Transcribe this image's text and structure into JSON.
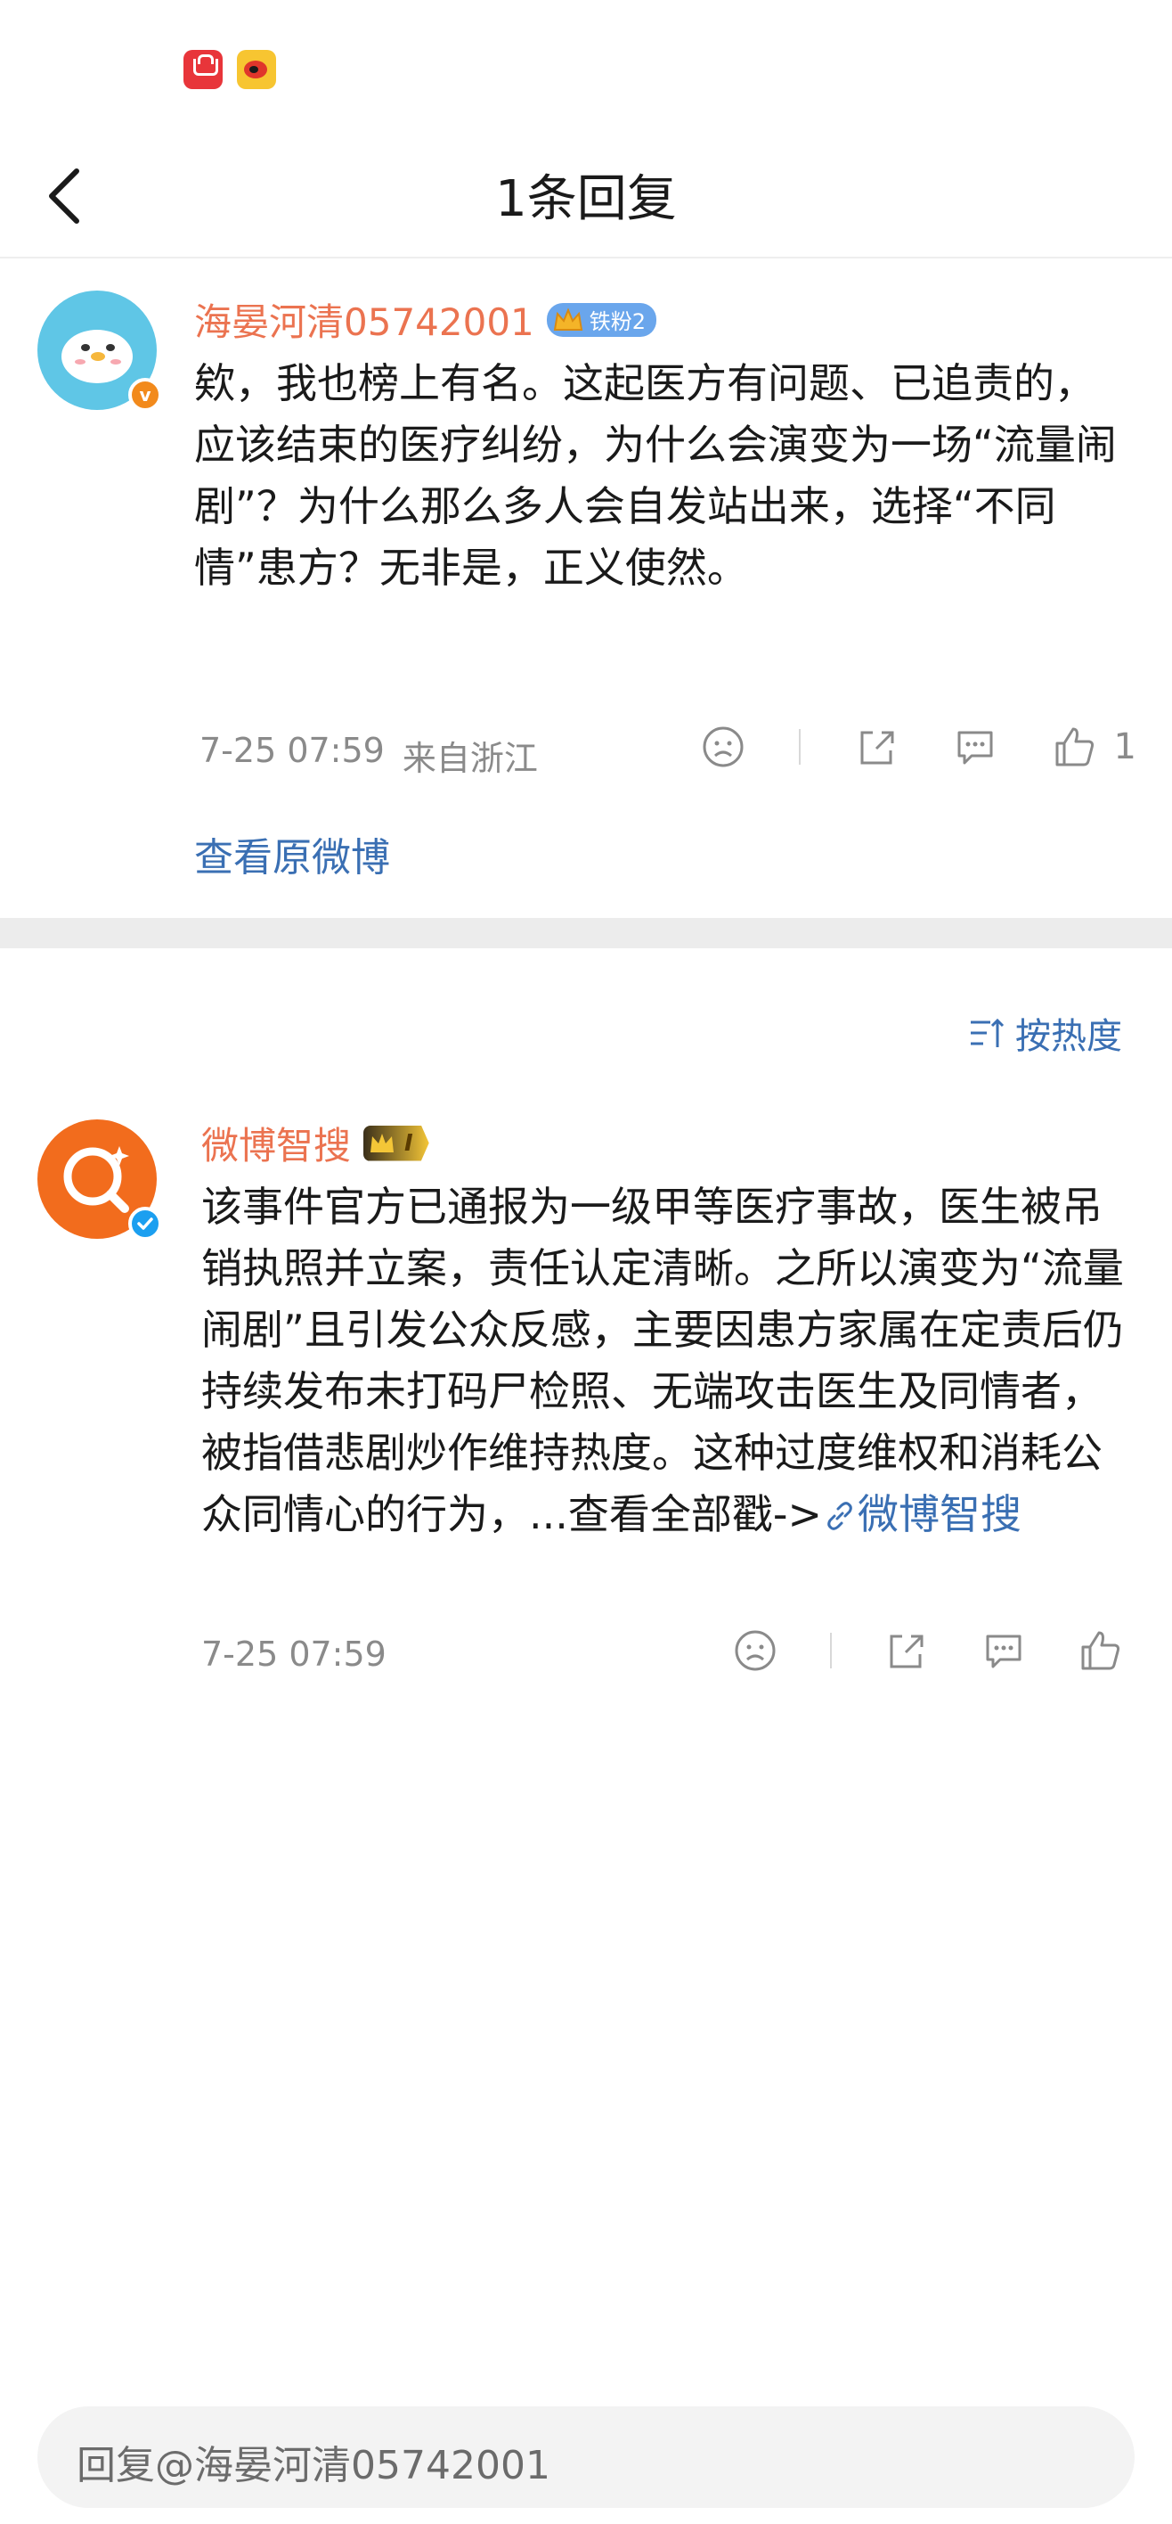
{
  "header": {
    "title": "1条回复",
    "back_icon": "chevron-left-icon"
  },
  "comment": {
    "username": "海晏河清05742001",
    "fan_badge": "铁粉2",
    "text": "欸，我也榜上有名。这起医方有问题、已追责的，应该结束的医疗纠纷，为什么会演变为一场“流量闹剧”？为什么那么多人会自发站出来，选择“不同情”患方？无非是，正义使然。",
    "time": "7-25 07:59",
    "location": "来自浙江",
    "like_count": "1",
    "view_original": "查看原微博",
    "avatar_badge": "v",
    "colors": {
      "username": "#eb7350",
      "link": "#3a6fb3",
      "avatar_bg": "#5fc6e6"
    }
  },
  "sort": {
    "label": "按热度"
  },
  "reply": {
    "username": "微博智搜",
    "level_badge": "I",
    "text": "该事件官方已通报为一级甲等医疗事故，医生被吊销执照并立案，责任认定清晰。之所以演变为“流量闹剧”且引发公众反感，主要因患方家属在定责后仍持续发布未打码尸检照、无端攻击医生及同情者，被指借悲剧炒作维持热度。这种过度维权和消耗公众同情心的行为，...查看全部戳->",
    "link_text": "微博智搜",
    "time": "7-25 07:59",
    "colors": {
      "avatar_bg": "#f26c1d",
      "badge": "#1b9ff0"
    }
  },
  "input": {
    "placeholder": "回复@海晏河清05742001"
  }
}
